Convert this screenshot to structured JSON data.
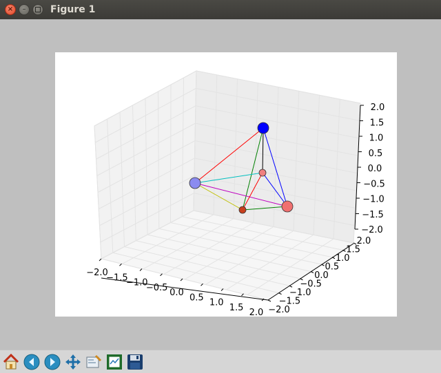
{
  "window": {
    "title": "Figure 1"
  },
  "toolbar": {
    "buttons": [
      {
        "name": "home-button",
        "icon": "home-icon"
      },
      {
        "name": "back-button",
        "icon": "arrow-left-icon"
      },
      {
        "name": "forward-button",
        "icon": "arrow-right-icon"
      },
      {
        "name": "pan-button",
        "icon": "move-icon"
      },
      {
        "name": "zoom-button",
        "icon": "zoom-rect-icon"
      },
      {
        "name": "subplots-button",
        "icon": "subplots-icon"
      },
      {
        "name": "save-button",
        "icon": "save-icon"
      }
    ]
  },
  "chart_data": {
    "type": "scatter",
    "projection": "3d",
    "grid": true,
    "xlim": [
      -2.0,
      2.0
    ],
    "ylim": [
      -2.0,
      2.0
    ],
    "zlim": [
      -2.0,
      2.0
    ],
    "x_ticks": [
      "−2.0",
      "−1.5",
      "−1.0",
      "−0.5",
      "0.0",
      "0.5",
      "1.0",
      "1.5",
      "2.0"
    ],
    "y_ticks": [
      "−2.0",
      "−1.5",
      "−1.0",
      "−0.5",
      "0.0",
      "0.5",
      "1.0",
      "1.5",
      "2.0"
    ],
    "z_ticks": [
      "−2.0",
      "−1.5",
      "−1.0",
      "−0.5",
      "0.0",
      "0.5",
      "1.0",
      "1.5",
      "2.0"
    ],
    "points": [
      {
        "id": "A",
        "color": "#0000ff",
        "size": 8
      },
      {
        "id": "B",
        "color": "#8b8bf0",
        "size": 8
      },
      {
        "id": "C",
        "color": "#f08080",
        "size": 5
      },
      {
        "id": "D",
        "color": "#f07070",
        "size": 8
      },
      {
        "id": "E",
        "color": "#c8401e",
        "size": 5
      }
    ],
    "edges": [
      {
        "from": "A",
        "to": "B",
        "color": "#ff0000"
      },
      {
        "from": "A",
        "to": "C",
        "color": "#000000"
      },
      {
        "from": "A",
        "to": "D",
        "color": "#0000ff"
      },
      {
        "from": "A",
        "to": "E",
        "color": "#008000"
      },
      {
        "from": "B",
        "to": "C",
        "color": "#00bfbf"
      },
      {
        "from": "B",
        "to": "D",
        "color": "#bf00bf"
      },
      {
        "from": "B",
        "to": "E",
        "color": "#bfbf00"
      },
      {
        "from": "C",
        "to": "D",
        "color": "#0000ff"
      },
      {
        "from": "C",
        "to": "E",
        "color": "#ff0000"
      },
      {
        "from": "D",
        "to": "E",
        "color": "#008000"
      }
    ]
  }
}
